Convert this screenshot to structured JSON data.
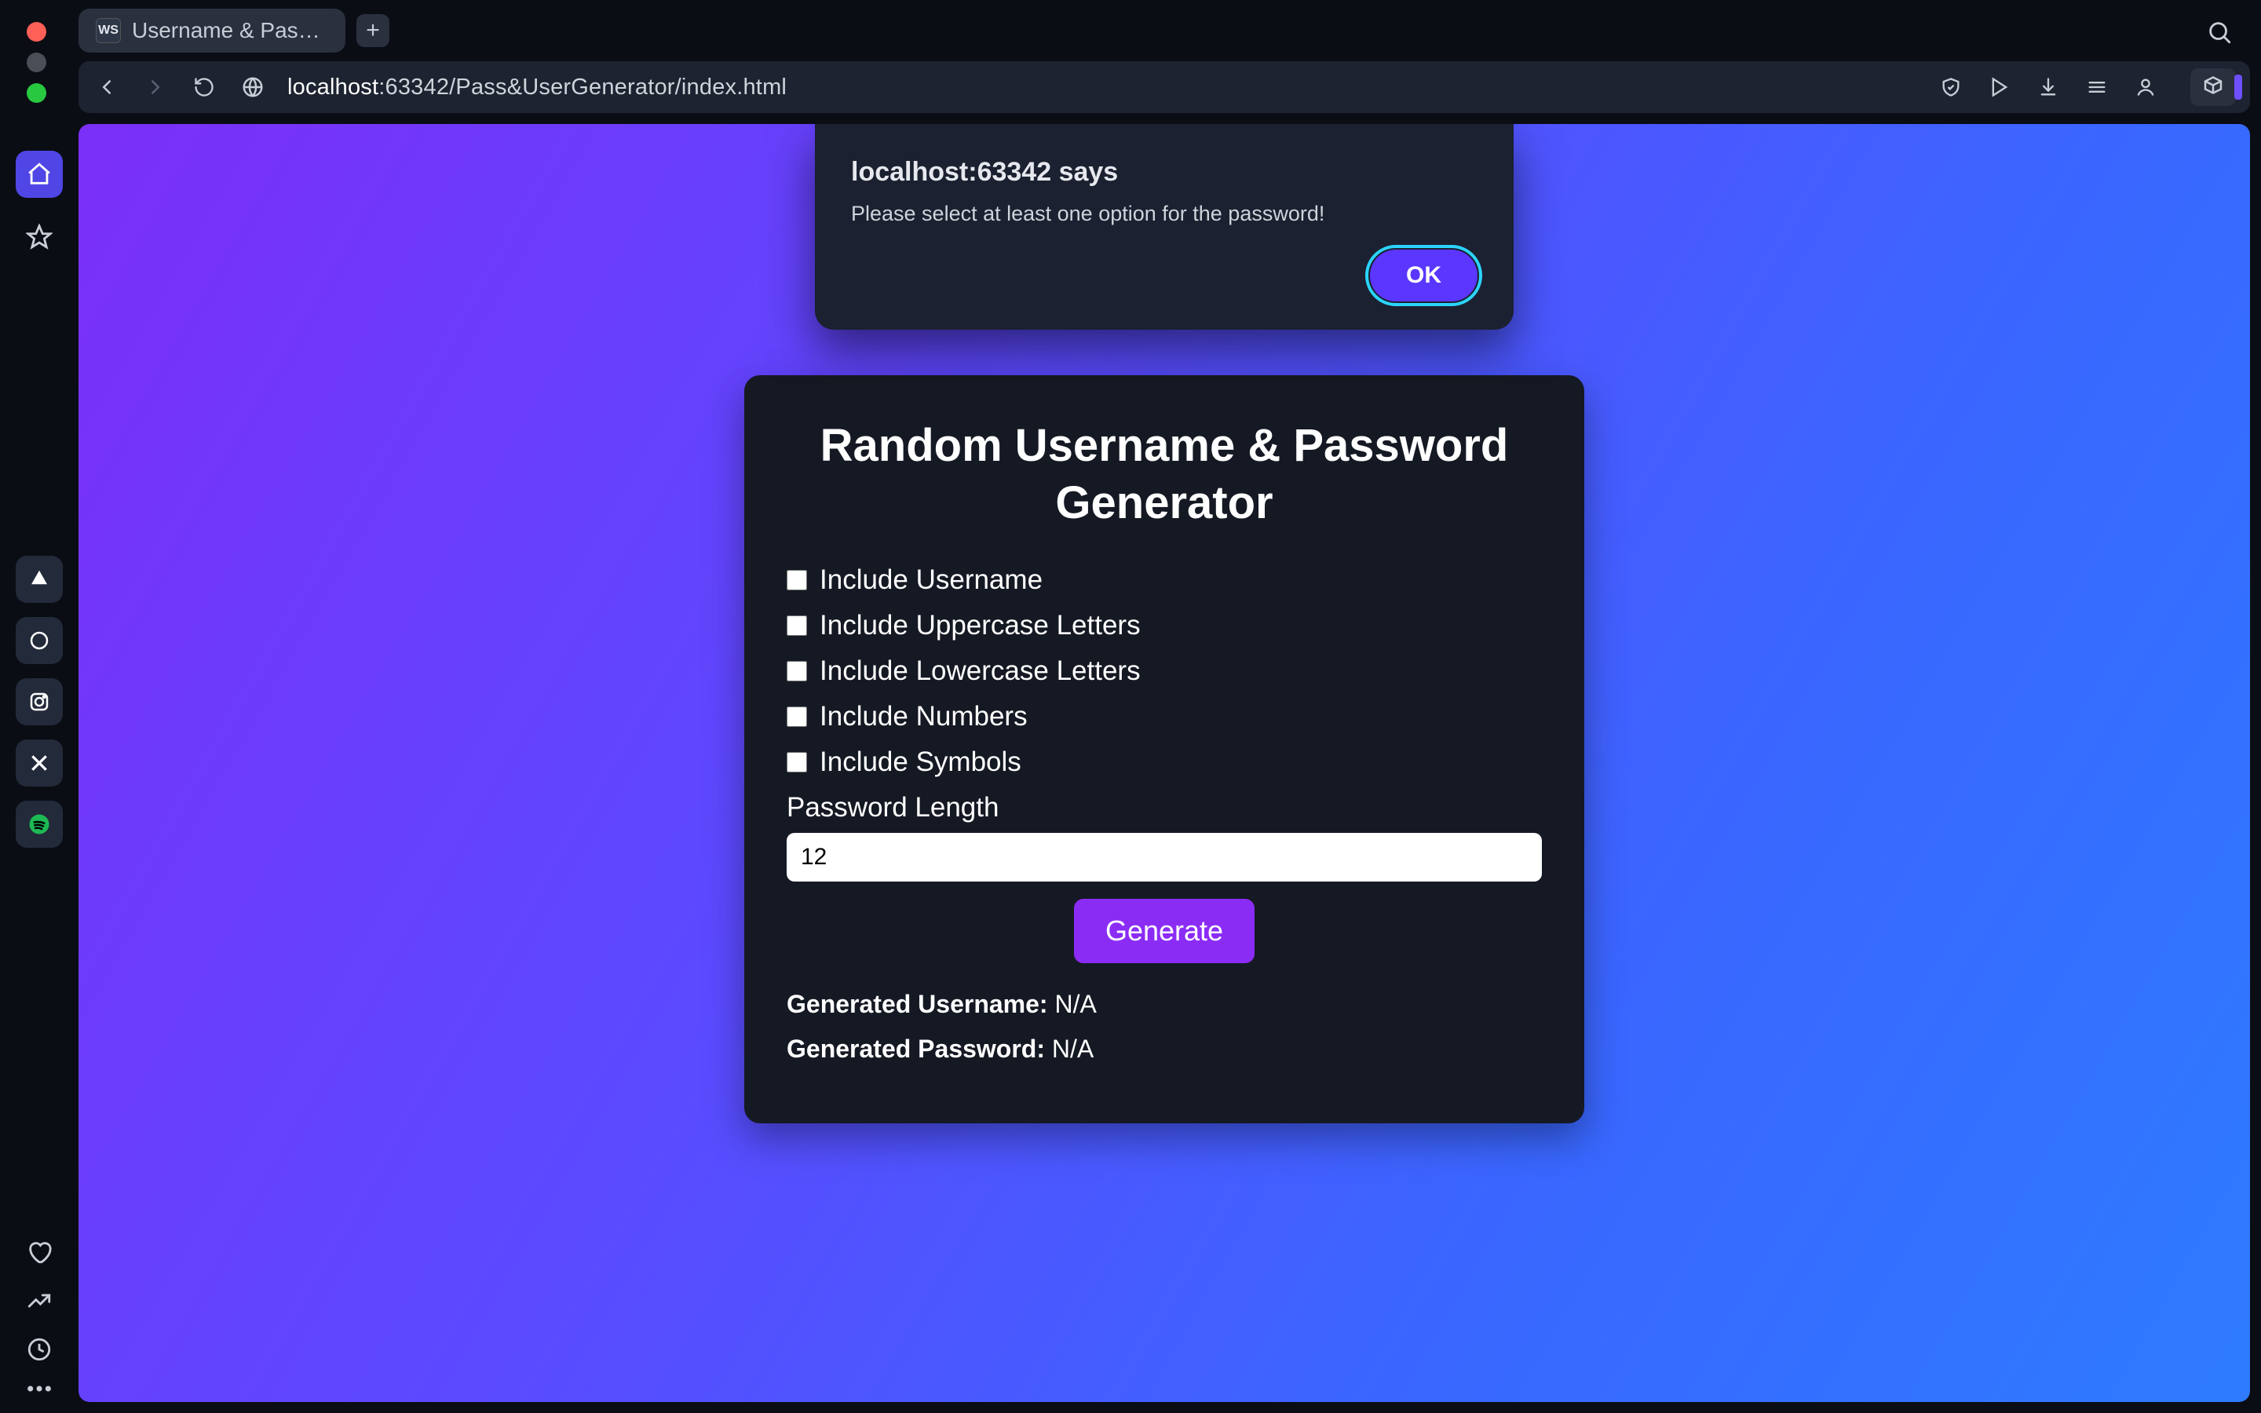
{
  "window": {
    "tab_title": "Username & Password G",
    "favicon_text": "WS"
  },
  "urlbar": {
    "scheme_host": "localhost",
    "rest": ":63342/Pass&UserGenerator/index.html"
  },
  "alert": {
    "title": "localhost:63342 says",
    "message": "Please select at least one option for the password!",
    "ok": "OK"
  },
  "page": {
    "title": "Random Username & Password Generator",
    "options": {
      "include_username": "Include Username",
      "include_uppercase": "Include Uppercase Letters",
      "include_lowercase": "Include Lowercase Letters",
      "include_numbers": "Include Numbers",
      "include_symbols": "Include Symbols"
    },
    "length_label": "Password Length",
    "length_value": "12",
    "generate": "Generate",
    "generated_username_label": "Generated Username:",
    "generated_username_value": "N/A",
    "generated_password_label": "Generated Password:",
    "generated_password_value": "N/A"
  },
  "colors": {
    "accent_purple": "#8b2cf5",
    "alert_ok": "#5b36ff",
    "focus_ring": "#2bd4ff",
    "gradient_start": "#7b2ff7",
    "gradient_end": "#2e7bff"
  }
}
